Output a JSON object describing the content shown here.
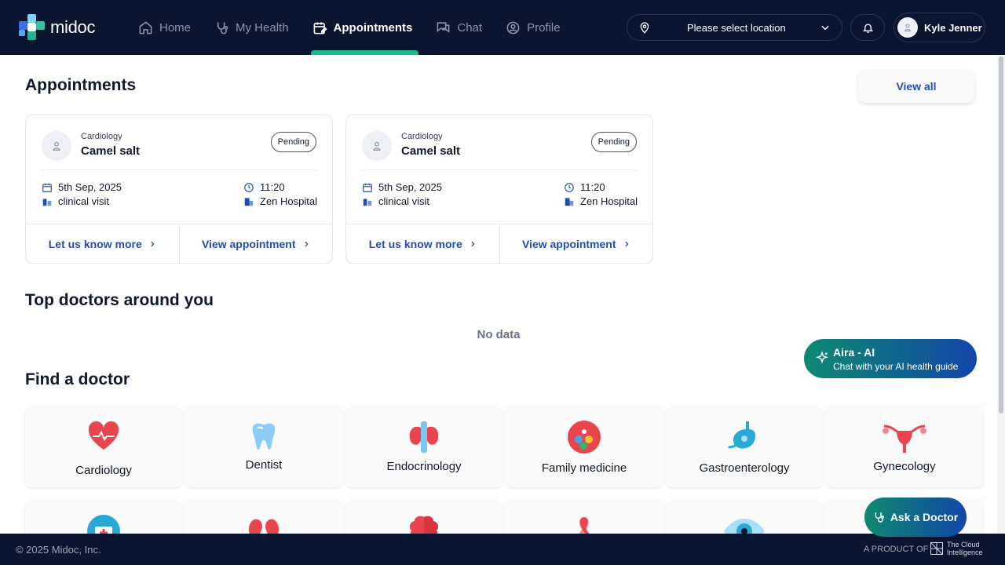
{
  "app": {
    "brand": "midoc"
  },
  "nav": {
    "items": [
      {
        "label": "Home",
        "icon": "home-icon"
      },
      {
        "label": "My Health",
        "icon": "stethoscope-icon"
      },
      {
        "label": "Appointments",
        "icon": "calendar-edit-icon",
        "active": true
      },
      {
        "label": "Chat",
        "icon": "chat-icon"
      },
      {
        "label": "Profile",
        "icon": "user-circle-icon"
      }
    ],
    "location_placeholder": "Please select location",
    "user_name": "Kyle Jenner"
  },
  "appointments": {
    "title": "Appointments",
    "view_all": "View all",
    "cards": [
      {
        "speciality": "Cardiology",
        "doctor": "Camel salt",
        "status": "Pending",
        "date": "5th Sep, 2025",
        "time": "11:20",
        "visit_type": "clinical visit",
        "hospital": "Zen Hospital",
        "link_more": "Let us know more",
        "link_view": "View appointment"
      },
      {
        "speciality": "Cardiology",
        "doctor": "Camel salt",
        "status": "Pending",
        "date": "5th Sep, 2025",
        "time": "11:20",
        "visit_type": "clinical visit",
        "hospital": "Zen Hospital",
        "link_more": "Let us know more",
        "link_view": "View appointment"
      }
    ]
  },
  "top_doctors": {
    "title": "Top doctors around you",
    "empty": "No data"
  },
  "aira": {
    "title": "Aira - AI",
    "subtitle": "Chat with your AI health guide"
  },
  "find_doctor": {
    "title": "Find a doctor",
    "specialities": [
      {
        "label": "Cardiology",
        "icon": "heart-icon"
      },
      {
        "label": "Dentist",
        "icon": "tooth-icon"
      },
      {
        "label": "Endocrinology",
        "icon": "thyroid-icon"
      },
      {
        "label": "Family medicine",
        "icon": "family-icon"
      },
      {
        "label": "Gastroenterology",
        "icon": "stomach-icon"
      },
      {
        "label": "Gynecology",
        "icon": "uterus-icon"
      }
    ],
    "row2_icons": [
      "medical-kit-icon",
      "kidney-icon",
      "brain-icon",
      "ribbon-icon",
      "eye-icon",
      ""
    ]
  },
  "ask_doctor": "Ask a Doctor",
  "footer": {
    "copyright": "© 2025 Midoc, Inc.",
    "product_of": "A PRODUCT OF",
    "company_line1": "The Cloud",
    "company_line2": "Intelligence"
  },
  "colors": {
    "nav_bg": "#0b1530",
    "accent_green": "#1fb58f",
    "link_blue": "#1f4fb3"
  }
}
